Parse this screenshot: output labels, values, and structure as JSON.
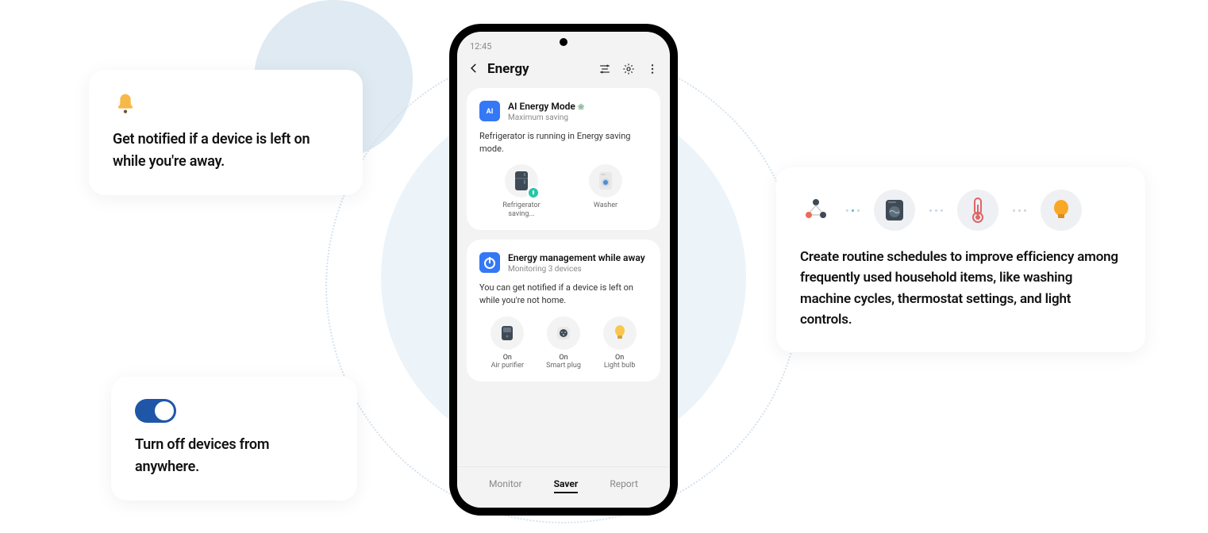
{
  "card_notify": {
    "text": "Get notified if a device is left on while you're away."
  },
  "card_toggle": {
    "text": "Turn off devices from anywhere."
  },
  "card_routine": {
    "text": "Create routine schedules to improve efficiency among frequently used household items, like washing machine cycles, thermostat settings, and light controls."
  },
  "phone": {
    "time": "12:45",
    "title": "Energy",
    "panel_ai": {
      "badge": "AI",
      "title": "AI Energy Mode",
      "sub": "Maximum saving",
      "msg": "Refrigerator is running in Energy saving mode.",
      "devices": [
        {
          "name": "Refrigerator",
          "state": "saving..."
        },
        {
          "name": "Washer",
          "state": ""
        }
      ]
    },
    "panel_away": {
      "title": "Energy management while away",
      "sub": "Monitoring 3 devices",
      "msg": "You can get notified if a device is left on while you're not home.",
      "devices": [
        {
          "name": "Air purifier",
          "state": "On"
        },
        {
          "name": "Smart plug",
          "state": "On"
        },
        {
          "name": "Light bulb",
          "state": "On"
        }
      ]
    },
    "tabs": {
      "monitor": "Monitor",
      "saver": "Saver",
      "report": "Report"
    }
  }
}
